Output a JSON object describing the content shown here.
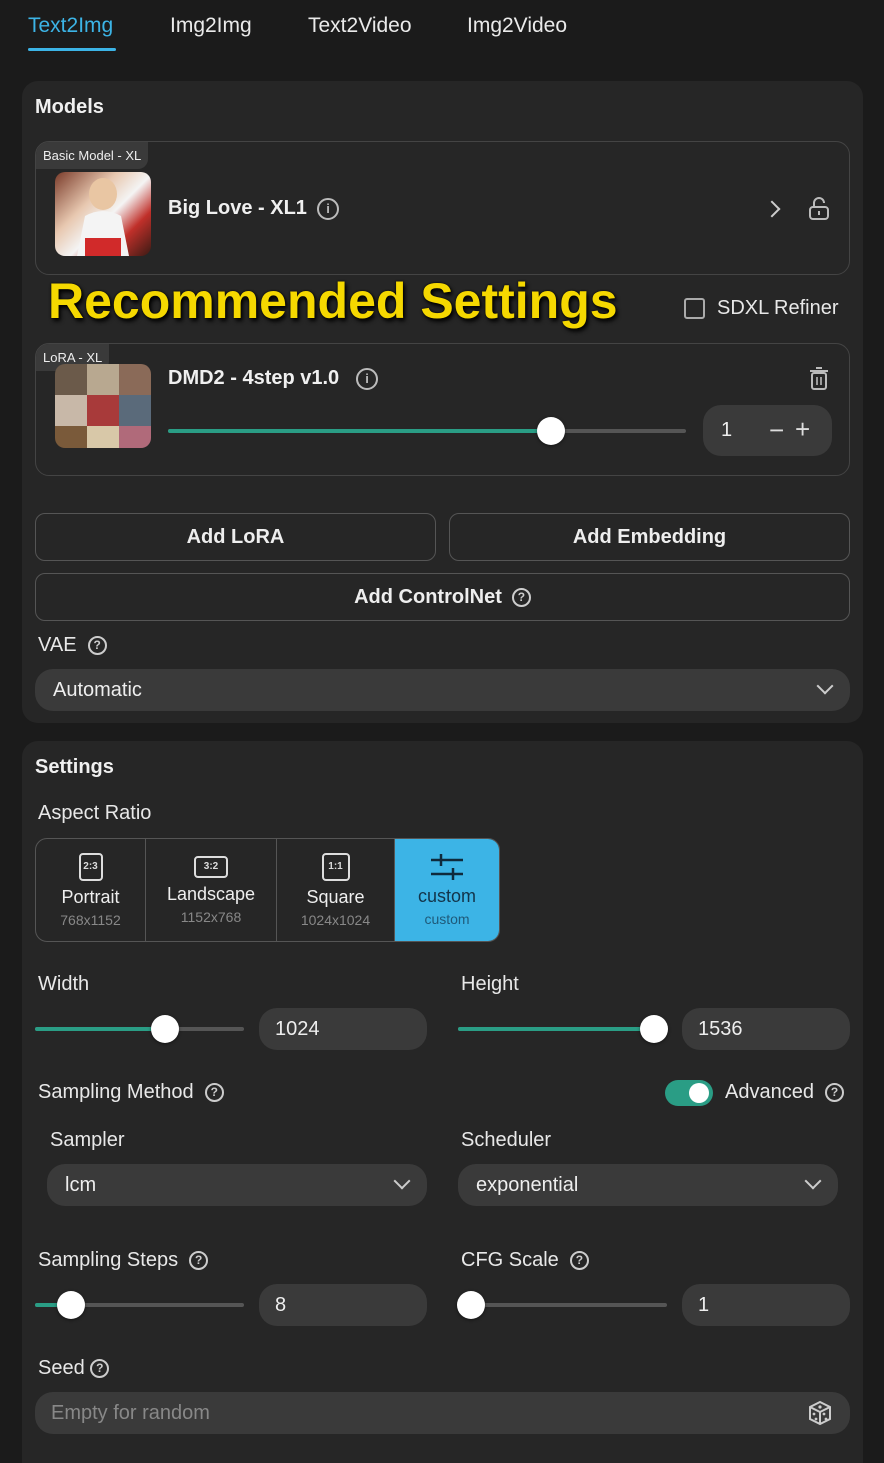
{
  "tabs": [
    {
      "label": "Text2Img",
      "active": true
    },
    {
      "label": "Img2Img",
      "active": false
    },
    {
      "label": "Text2Video",
      "active": false
    },
    {
      "label": "Img2Video",
      "active": false
    }
  ],
  "models": {
    "title": "Models",
    "basic_model": {
      "tag": "Basic Model - XL",
      "name": "Big Love - XL1"
    },
    "overlay_text": "Recommended Settings",
    "refiner": {
      "label": "SDXL Refiner",
      "checked": false
    },
    "lora": {
      "tag": "LoRA - XL",
      "name": "DMD2 - 4step v1.0",
      "weight": "1",
      "slider_fraction": 0.74
    },
    "add_lora": "Add LoRA",
    "add_embedding": "Add Embedding",
    "add_controlnet": "Add ControlNet",
    "vae_label": "VAE",
    "vae_value": "Automatic"
  },
  "settings": {
    "title": "Settings",
    "aspect_ratio_label": "Aspect Ratio",
    "aspect_options": [
      {
        "icon": "2:3",
        "name": "Portrait",
        "size": "768x1152",
        "selected": false
      },
      {
        "icon": "3:2",
        "name": "Landscape",
        "size": "1152x768",
        "selected": false
      },
      {
        "icon": "1:1",
        "name": "Square",
        "size": "1024x1024",
        "selected": false
      },
      {
        "icon": "sliders-icon",
        "name": "custom",
        "size": "custom",
        "selected": true
      }
    ],
    "width": {
      "label": "Width",
      "value": "1024",
      "slider_fraction": 0.62
    },
    "height": {
      "label": "Height",
      "value": "1536",
      "slider_fraction": 0.94
    },
    "sampling_method_label": "Sampling Method",
    "advanced": {
      "label": "Advanced",
      "on": true
    },
    "sampler": {
      "label": "Sampler",
      "value": "lcm"
    },
    "scheduler": {
      "label": "Scheduler",
      "value": "exponential"
    },
    "sampling_steps": {
      "label": "Sampling Steps",
      "value": "8",
      "slider_fraction": 0.17
    },
    "cfg_scale": {
      "label": "CFG Scale",
      "value": "1",
      "slider_fraction": 0.06
    },
    "seed": {
      "label": "Seed",
      "placeholder": "Empty for random"
    }
  },
  "colors": {
    "accent": "#3cb4e6",
    "slider": "#2a9d85",
    "overlay_text": "#f5d800"
  }
}
